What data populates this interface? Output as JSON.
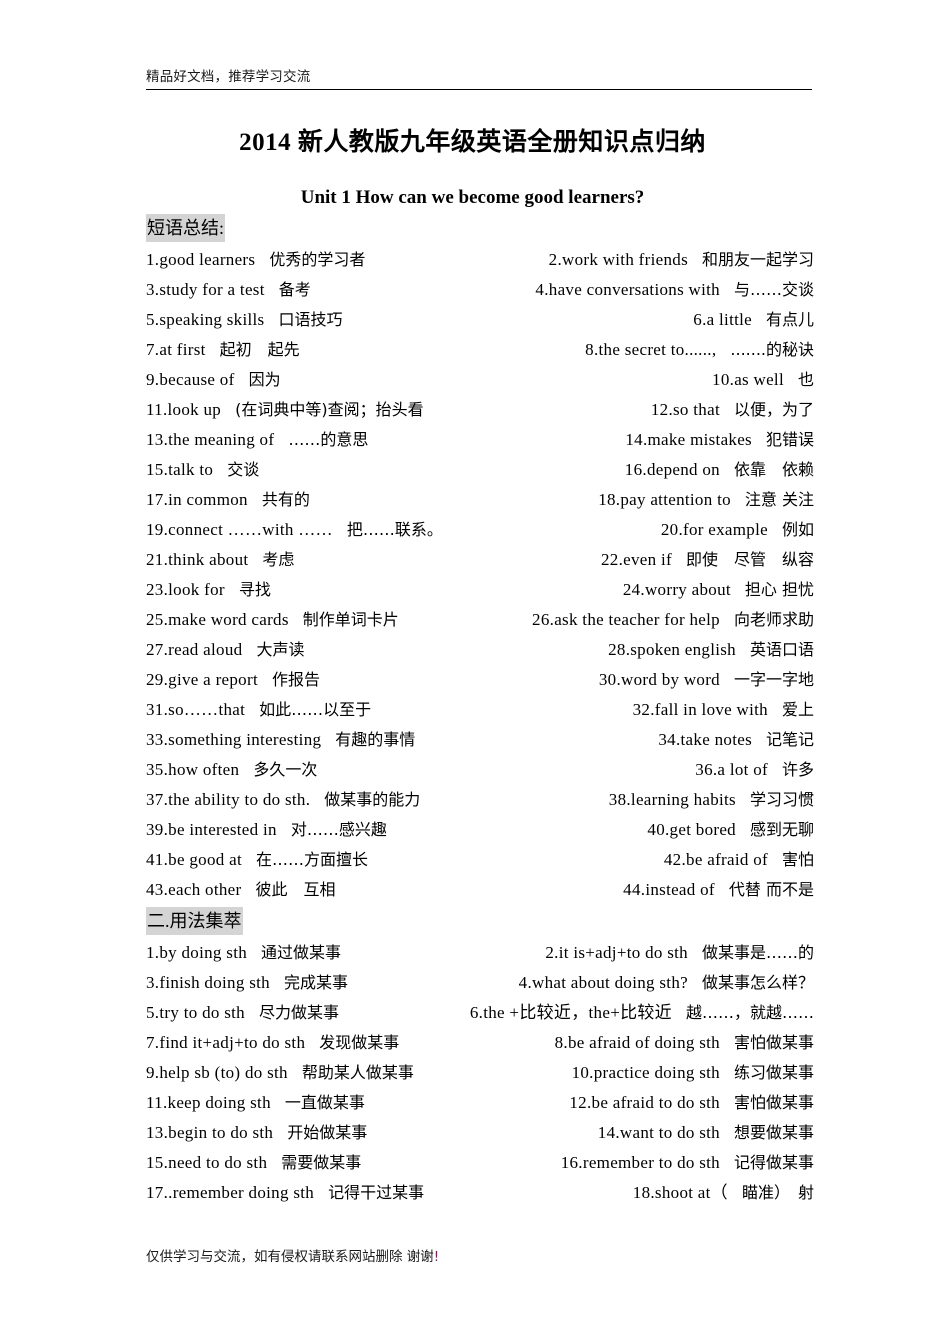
{
  "header": {
    "text": "精品好文档，推荐学习交流"
  },
  "title": "2014 新人教版九年级英语全册知识点归纳",
  "unit_title": "Unit 1    How can we become good learners?",
  "sections": [
    {
      "heading": "短语总结:",
      "rows": [
        {
          "left_num": "1.",
          "left_en": "good  learners",
          "left_cn": "优秀的学习者",
          "right_num": "2.",
          "right_en": "work  with  friends",
          "right_cn": "和朋友一起学习"
        },
        {
          "left_num": "3.",
          "left_en": "study  for  a  test",
          "left_cn": "备考",
          "right_num": "4.",
          "right_en": "have  conversations  with",
          "right_cn": "与……交谈"
        },
        {
          "left_num": "5.",
          "left_en": "speaking  skills",
          "left_cn": "口语技巧",
          "right_num": "6.",
          "right_en": "a  little",
          "right_cn": "有点儿"
        },
        {
          "left_num": "7.",
          "left_en": "at  first",
          "left_cn": "起初　起先",
          "right_num": "8.",
          "right_en": "the     secret  to......,",
          "right_cn": ".......的秘诀"
        },
        {
          "left_num": "9.",
          "left_en": "because  of",
          "left_cn": "因为",
          "right_num": "10.",
          "right_en": "as  well",
          "right_cn": "也"
        },
        {
          "left_num": "11.",
          "left_en": "look  up",
          "left_cn": "(在词典中等)查阅；抬头看",
          "right_num": "12.",
          "right_en": "so  that",
          "right_cn": "以便，为了"
        },
        {
          "left_num": "13.",
          "left_en": "the  meaning     of",
          "left_cn": "……的意思",
          "right_num": "14.",
          "right_en": "make  mistakes",
          "right_cn": "犯错误"
        },
        {
          "left_num": "15.",
          "left_en": "talk  to",
          "left_cn": "交谈",
          "right_num": "16.",
          "right_en": "depend  on",
          "right_cn": "依靠　依赖"
        },
        {
          "left_num": "17.",
          "left_en": "in  common",
          "left_cn": "共有的",
          "right_num": "18.",
          "right_en": "pay  attention    to",
          "right_cn": "注意 关注"
        },
        {
          "left_num": "19.",
          "left_en": "connect  ……with  ……",
          "left_cn": "把……联系。",
          "right_num": "20.",
          "right_en": "for    example",
          "right_cn": "例如"
        },
        {
          "left_num": "21.",
          "left_en": "think  about",
          "left_cn": "考虑",
          "right_num": "22.",
          "right_en": "even  if",
          "right_cn": "即使　尽管　纵容"
        },
        {
          "left_num": "23.",
          "left_en": "look  for",
          "left_cn": "寻找",
          "right_num": "24.",
          "right_en": "worry  about",
          "right_cn": "担心 担忧"
        },
        {
          "left_num": "25.",
          "left_en": "make  word  cards",
          "left_cn": "制作单词卡片",
          "right_num": "26.",
          "right_en": "ask  the  teacher  for  help",
          "right_cn": "向老师求助"
        },
        {
          "left_num": "27.",
          "left_en": "read  aloud",
          "left_cn": "大声读",
          "right_num": "28.",
          "right_en": "spoken  english",
          "right_cn": "英语口语"
        },
        {
          "left_num": "29.",
          "left_en": "give  a  report",
          "left_cn": "作报告",
          "right_num": "30.",
          "right_en": "word  by  word",
          "right_cn": "一字一字地"
        },
        {
          "left_num": "31.",
          "left_en": "so……that",
          "left_cn": "如此……以至于",
          "right_num": "32.",
          "right_en": "fall  in  love  with",
          "right_cn": "爱上"
        },
        {
          "left_num": "33.",
          "left_en": "something     interesting",
          "left_cn": "有趣的事情",
          "right_num": "34.",
          "right_en": "take  notes",
          "right_cn": "记笔记"
        },
        {
          "left_num": "35.",
          "left_en": "how  often",
          "left_cn": "多久一次",
          "right_num": "36.",
          "right_en": "a  lot  of",
          "right_cn": "许多"
        },
        {
          "left_num": "37.",
          "left_en": "the     ability     to do sth.",
          "left_cn": "做某事的能力",
          "right_num": "38.",
          "right_en": "learning     habits",
          "right_cn": "学习习惯"
        },
        {
          "left_num": "39.",
          "left_en": "be     interested     in",
          "left_cn": "对……感兴趣",
          "right_num": "40.",
          "right_en": "get  bored",
          "right_cn": "感到无聊"
        },
        {
          "left_num": "41.",
          "left_en": "be  good  at",
          "left_cn": "在……方面擅长",
          "right_num": "42.",
          "right_en": "be  afraid  of",
          "right_cn": "害怕"
        },
        {
          "left_num": "43.",
          "left_en": "each other",
          "left_cn": "彼此　互相",
          "right_num": "44.",
          "right_en": "instead  of",
          "right_cn": "代替 而不是"
        }
      ]
    },
    {
      "heading": "二.用法集萃",
      "rows": [
        {
          "left_num": "1.",
          "left_en": "   by doing sth",
          "left_cn": "通过做某事",
          "right_num": "2.",
          "right_en": "it is+adj+to  do  sth",
          "right_cn": "做某事是……的"
        },
        {
          "left_num": "3.",
          "left_en": "finish doing sth",
          "left_cn": "完成某事",
          "right_num": "4.",
          "right_en": "what about doing sth?",
          "right_cn": "做某事怎么样？"
        },
        {
          "left_num": "5.",
          "left_en": "try to do sth",
          "left_cn": "尽力做某事",
          "right_num": "6.",
          "right_en": "the +比较近，the+比较近",
          "right_cn": "越……，就越……"
        },
        {
          "left_num": "7.",
          "left_en": "find it+adj+to  do  sth",
          "left_cn": "发现做某事",
          "right_num": "8.",
          "right_en": "be afraid    of    doing sth",
          "right_cn": "害怕做某事"
        },
        {
          "left_num": "9.",
          "left_en": "help sb (to) do    sth",
          "left_cn": "帮助某人做某事",
          "right_num": "10.",
          "right_en": "practice    doing    sth",
          "right_cn": "练习做某事"
        },
        {
          "left_num": "11.",
          "left_en": "keep doing sth",
          "left_cn": "一直做某事",
          "right_num": "12.",
          "right_en": "be  afraid to do sth",
          "right_cn": "害怕做某事"
        },
        {
          "left_num": "13.",
          "left_en": "begin to do sth",
          "left_cn": "开始做某事",
          "right_num": "14.",
          "right_en": "want    to    do sth",
          "right_cn": "想要做某事"
        },
        {
          "left_num": "15.",
          "left_en": "need to do sth",
          "left_cn": "需要做某事",
          "right_num": "16.",
          "right_en": "remember to do sth",
          "right_cn": "记得做某事"
        },
        {
          "left_num": "17.",
          "left_en": ".remember doing sth",
          "left_cn": "记得干过某事",
          "right_num": "18.",
          "right_en": "shoot    at（",
          "right_cn": "瞄准）　射"
        }
      ]
    }
  ],
  "footer": {
    "text": "仅供学习与交流，如有侵权请联系网站删除  谢谢",
    "mark": "!"
  }
}
